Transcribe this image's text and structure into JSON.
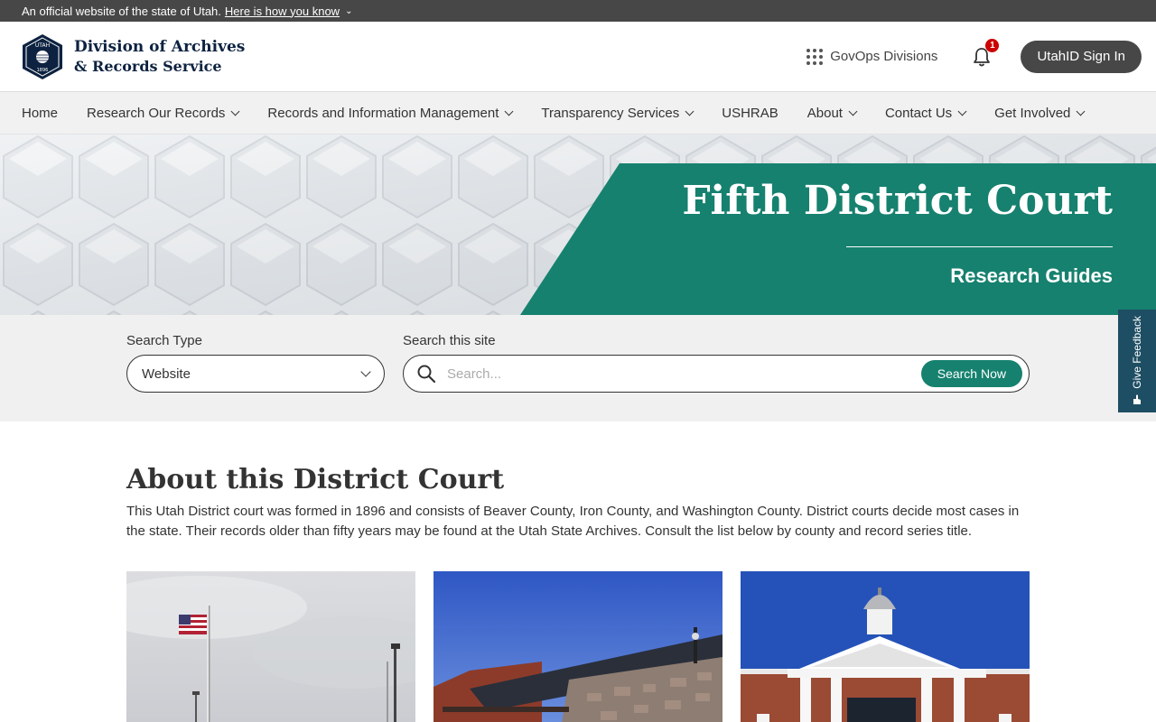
{
  "official_bar": {
    "text": "An official website of the state of Utah.",
    "link": "Here is how you know"
  },
  "header": {
    "seal_text_top": "UTAH",
    "seal_text_bottom": "1896",
    "logo_line1": "Division of Archives",
    "logo_line2": "& Records Service",
    "govops_label": "GovOps Divisions",
    "notification_count": "1",
    "signin_label": "UtahID Sign In"
  },
  "nav": {
    "items": [
      {
        "label": "Home",
        "dropdown": false
      },
      {
        "label": "Research Our Records",
        "dropdown": true
      },
      {
        "label": "Records and Information Management",
        "dropdown": true
      },
      {
        "label": "Transparency Services",
        "dropdown": true
      },
      {
        "label": "USHRAB",
        "dropdown": false
      },
      {
        "label": "About",
        "dropdown": true
      },
      {
        "label": "Contact Us",
        "dropdown": true
      },
      {
        "label": "Get Involved",
        "dropdown": true
      }
    ]
  },
  "hero": {
    "title": "Fifth District Court",
    "subtitle": "Research Guides"
  },
  "search": {
    "type_label": "Search Type",
    "type_value": "Website",
    "site_label": "Search this site",
    "placeholder": "Search...",
    "button_label": "Search Now"
  },
  "feedback": {
    "label": "Give Feedback"
  },
  "about": {
    "title": "About this District Court",
    "text": "This Utah District court was formed in 1896 and consists of Beaver County, Iron County, and Washington County. District courts decide most cases in the state. Their records older than fifty years may be found at the Utah State Archives. Consult the list below by county and record series title."
  },
  "colors": {
    "teal": "#16816f",
    "dark_bar": "#474747",
    "navy": "#0d2240",
    "feedback": "#1e4e63"
  }
}
